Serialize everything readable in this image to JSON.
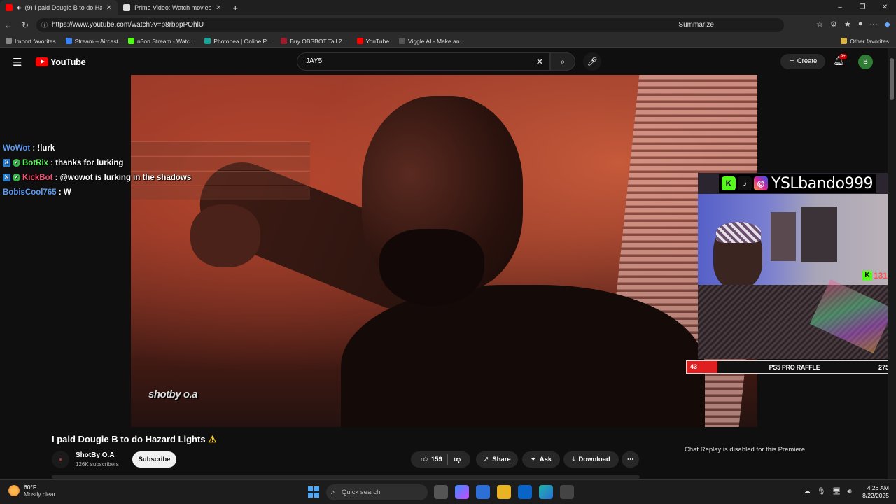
{
  "browser": {
    "tabs": [
      {
        "title": "(9) I paid Dougie B to do Ha",
        "active": true,
        "color": "#ff0000"
      },
      {
        "title": "Prime Video: Watch movies, TV sh",
        "active": false,
        "color": "#1a1a1a"
      }
    ],
    "url": "https://www.youtube.com/watch?v=p8rbppPOhlU",
    "summarize_label": "Summarize",
    "favorites": [
      {
        "label": "Import favorites",
        "color": "#888888"
      },
      {
        "label": "Stream – Aircast",
        "color": "#3b82f6"
      },
      {
        "label": "n3on Stream - Watc...",
        "color": "#53fc18"
      },
      {
        "label": "Photopea | Online P...",
        "color": "#18a497"
      },
      {
        "label": "Buy OBSBOT Tail 2...",
        "color": "#9b1c2c"
      },
      {
        "label": "YouTube",
        "color": "#ff0000"
      },
      {
        "label": "Viggle AI - Make an...",
        "color": "#222222"
      }
    ],
    "other_favorites": "Other favorites"
  },
  "youtube": {
    "logo_text": "YouTube",
    "search_value": "JAY5",
    "create_label": "Create",
    "notif_badge": "9+",
    "avatar_letter": "B"
  },
  "chat": [
    {
      "user": "WoWot",
      "user_color": "#5b9bf5",
      "badges": [],
      "message": " : !lurk"
    },
    {
      "user": "BotRix",
      "user_color": "#5ef05e",
      "badges": [
        "mod",
        "verified"
      ],
      "message": " : thanks for lurking"
    },
    {
      "user": "KickBot",
      "user_color": "#f0506e",
      "badges": [
        "mod",
        "verified"
      ],
      "message": " : @wowot is lurking in the shadows"
    },
    {
      "user": "BobisCool765",
      "user_color": "#5b9bf5",
      "badges": [],
      "message": " : W"
    }
  ],
  "overlay": {
    "handle": "YSLbando999",
    "kick_count": "1311",
    "raffle_left": "43",
    "raffle_title": "PS5 PRO RAFFLE",
    "raffle_right": "275",
    "watermark": "shotby o.a"
  },
  "video": {
    "title": "I paid Dougie B to do Hazard Lights",
    "warning_icon": "⚠",
    "channel": "ShotBy O.A",
    "subscribers": "126K subscribers",
    "subscribe_label": "Subscribe",
    "likes": "159",
    "share_label": "Share",
    "ask_label": "Ask",
    "download_label": "Download",
    "chat_replay_note": "Chat Replay is disabled for this Premiere."
  },
  "taskbar": {
    "temp": "60°F",
    "weather": "Mostly clear",
    "search_placeholder": "Quick search",
    "time": "4:26 AM",
    "date": "8/22/2025"
  }
}
